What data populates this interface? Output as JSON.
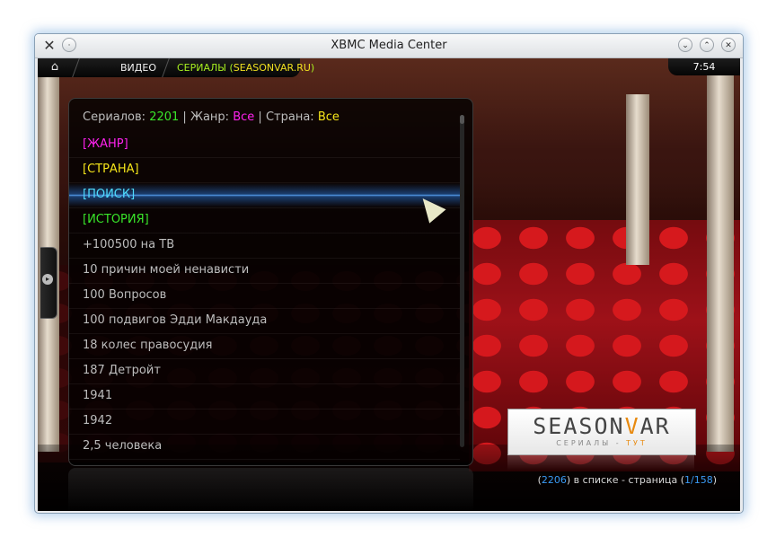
{
  "window": {
    "title": "XBMC Media Center",
    "app_icon": "xbmc-x-icon",
    "controls": [
      "minimize-icon",
      "maximize-icon",
      "close-icon"
    ]
  },
  "topbar": {
    "home_icon": "home-icon",
    "crumb_video": "ВИДЕО",
    "crumb_series_prefix": "СЕРИАЛЫ (",
    "crumb_series_site": "SEASONVAR.RU",
    "crumb_series_suffix": ")",
    "clock": "7:54"
  },
  "panel": {
    "header": {
      "series_label": "Сериалов:",
      "series_count": "2201",
      "sep1": "|",
      "genre_label": "Жанр:",
      "genre_value": "Все",
      "sep2": "|",
      "country_label": "Страна:",
      "country_value": "Все"
    },
    "items": [
      {
        "label": "[ЖАНР]",
        "style": "magenta"
      },
      {
        "label": "[СТРАНА]",
        "style": "yellow"
      },
      {
        "label": "[ПОИСК]",
        "style": "cyan",
        "focused": true
      },
      {
        "label": "[ИСТОРИЯ]",
        "style": "green"
      },
      {
        "label": "+100500 на ТВ",
        "style": "normal"
      },
      {
        "label": "10 причин моей ненависти",
        "style": "normal"
      },
      {
        "label": "100 Вопросов",
        "style": "normal"
      },
      {
        "label": "100 подвигов Эдди Макдауда",
        "style": "normal"
      },
      {
        "label": "18 колес правосудия",
        "style": "normal"
      },
      {
        "label": "187 Детройт",
        "style": "normal"
      },
      {
        "label": "1941",
        "style": "normal"
      },
      {
        "label": "1942",
        "style": "normal"
      },
      {
        "label": "2,5 человека",
        "style": "normal"
      }
    ]
  },
  "logo": {
    "main_a": "SEASON",
    "main_b": "V",
    "main_c": "AR",
    "sub_a": "СЕРИАЛЫ - ",
    "sub_b": "ТУТ"
  },
  "status": {
    "open1": "(",
    "count": "2206",
    "middle": ") в списке - страница (",
    "page": "1/158",
    "close": ")"
  },
  "colors": {
    "green": "#39e52a",
    "magenta": "#ff22ee",
    "yellow": "#f5e51a",
    "cyan": "#4fdcff",
    "link_blue": "#3a9bf5"
  }
}
